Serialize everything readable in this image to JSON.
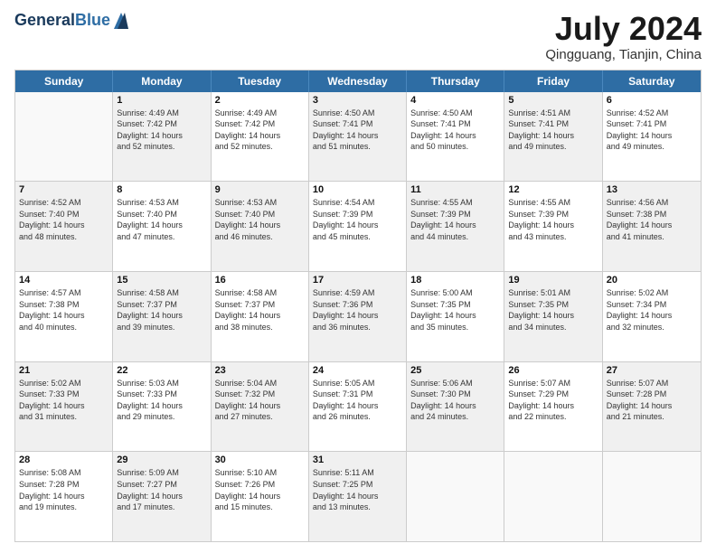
{
  "logo": {
    "general": "General",
    "blue": "Blue"
  },
  "title": "July 2024",
  "location": "Qingguang, Tianjin, China",
  "days_of_week": [
    "Sunday",
    "Monday",
    "Tuesday",
    "Wednesday",
    "Thursday",
    "Friday",
    "Saturday"
  ],
  "weeks": [
    [
      {
        "day": "",
        "sunrise": "",
        "sunset": "",
        "daylight": "",
        "shaded": false,
        "empty": true
      },
      {
        "day": "1",
        "sunrise": "Sunrise: 4:49 AM",
        "sunset": "Sunset: 7:42 PM",
        "daylight": "Daylight: 14 hours and 52 minutes.",
        "shaded": true
      },
      {
        "day": "2",
        "sunrise": "Sunrise: 4:49 AM",
        "sunset": "Sunset: 7:42 PM",
        "daylight": "Daylight: 14 hours and 52 minutes.",
        "shaded": false
      },
      {
        "day": "3",
        "sunrise": "Sunrise: 4:50 AM",
        "sunset": "Sunset: 7:41 PM",
        "daylight": "Daylight: 14 hours and 51 minutes.",
        "shaded": true
      },
      {
        "day": "4",
        "sunrise": "Sunrise: 4:50 AM",
        "sunset": "Sunset: 7:41 PM",
        "daylight": "Daylight: 14 hours and 50 minutes.",
        "shaded": false
      },
      {
        "day": "5",
        "sunrise": "Sunrise: 4:51 AM",
        "sunset": "Sunset: 7:41 PM",
        "daylight": "Daylight: 14 hours and 49 minutes.",
        "shaded": true
      },
      {
        "day": "6",
        "sunrise": "Sunrise: 4:52 AM",
        "sunset": "Sunset: 7:41 PM",
        "daylight": "Daylight: 14 hours and 49 minutes.",
        "shaded": false
      }
    ],
    [
      {
        "day": "7",
        "sunrise": "Sunrise: 4:52 AM",
        "sunset": "Sunset: 7:40 PM",
        "daylight": "Daylight: 14 hours and 48 minutes.",
        "shaded": true
      },
      {
        "day": "8",
        "sunrise": "Sunrise: 4:53 AM",
        "sunset": "Sunset: 7:40 PM",
        "daylight": "Daylight: 14 hours and 47 minutes.",
        "shaded": false
      },
      {
        "day": "9",
        "sunrise": "Sunrise: 4:53 AM",
        "sunset": "Sunset: 7:40 PM",
        "daylight": "Daylight: 14 hours and 46 minutes.",
        "shaded": true
      },
      {
        "day": "10",
        "sunrise": "Sunrise: 4:54 AM",
        "sunset": "Sunset: 7:39 PM",
        "daylight": "Daylight: 14 hours and 45 minutes.",
        "shaded": false
      },
      {
        "day": "11",
        "sunrise": "Sunrise: 4:55 AM",
        "sunset": "Sunset: 7:39 PM",
        "daylight": "Daylight: 14 hours and 44 minutes.",
        "shaded": true
      },
      {
        "day": "12",
        "sunrise": "Sunrise: 4:55 AM",
        "sunset": "Sunset: 7:39 PM",
        "daylight": "Daylight: 14 hours and 43 minutes.",
        "shaded": false
      },
      {
        "day": "13",
        "sunrise": "Sunrise: 4:56 AM",
        "sunset": "Sunset: 7:38 PM",
        "daylight": "Daylight: 14 hours and 41 minutes.",
        "shaded": true
      }
    ],
    [
      {
        "day": "14",
        "sunrise": "Sunrise: 4:57 AM",
        "sunset": "Sunset: 7:38 PM",
        "daylight": "Daylight: 14 hours and 40 minutes.",
        "shaded": false
      },
      {
        "day": "15",
        "sunrise": "Sunrise: 4:58 AM",
        "sunset": "Sunset: 7:37 PM",
        "daylight": "Daylight: 14 hours and 39 minutes.",
        "shaded": true
      },
      {
        "day": "16",
        "sunrise": "Sunrise: 4:58 AM",
        "sunset": "Sunset: 7:37 PM",
        "daylight": "Daylight: 14 hours and 38 minutes.",
        "shaded": false
      },
      {
        "day": "17",
        "sunrise": "Sunrise: 4:59 AM",
        "sunset": "Sunset: 7:36 PM",
        "daylight": "Daylight: 14 hours and 36 minutes.",
        "shaded": true
      },
      {
        "day": "18",
        "sunrise": "Sunrise: 5:00 AM",
        "sunset": "Sunset: 7:35 PM",
        "daylight": "Daylight: 14 hours and 35 minutes.",
        "shaded": false
      },
      {
        "day": "19",
        "sunrise": "Sunrise: 5:01 AM",
        "sunset": "Sunset: 7:35 PM",
        "daylight": "Daylight: 14 hours and 34 minutes.",
        "shaded": true
      },
      {
        "day": "20",
        "sunrise": "Sunrise: 5:02 AM",
        "sunset": "Sunset: 7:34 PM",
        "daylight": "Daylight: 14 hours and 32 minutes.",
        "shaded": false
      }
    ],
    [
      {
        "day": "21",
        "sunrise": "Sunrise: 5:02 AM",
        "sunset": "Sunset: 7:33 PM",
        "daylight": "Daylight: 14 hours and 31 minutes.",
        "shaded": true
      },
      {
        "day": "22",
        "sunrise": "Sunrise: 5:03 AM",
        "sunset": "Sunset: 7:33 PM",
        "daylight": "Daylight: 14 hours and 29 minutes.",
        "shaded": false
      },
      {
        "day": "23",
        "sunrise": "Sunrise: 5:04 AM",
        "sunset": "Sunset: 7:32 PM",
        "daylight": "Daylight: 14 hours and 27 minutes.",
        "shaded": true
      },
      {
        "day": "24",
        "sunrise": "Sunrise: 5:05 AM",
        "sunset": "Sunset: 7:31 PM",
        "daylight": "Daylight: 14 hours and 26 minutes.",
        "shaded": false
      },
      {
        "day": "25",
        "sunrise": "Sunrise: 5:06 AM",
        "sunset": "Sunset: 7:30 PM",
        "daylight": "Daylight: 14 hours and 24 minutes.",
        "shaded": true
      },
      {
        "day": "26",
        "sunrise": "Sunrise: 5:07 AM",
        "sunset": "Sunset: 7:29 PM",
        "daylight": "Daylight: 14 hours and 22 minutes.",
        "shaded": false
      },
      {
        "day": "27",
        "sunrise": "Sunrise: 5:07 AM",
        "sunset": "Sunset: 7:28 PM",
        "daylight": "Daylight: 14 hours and 21 minutes.",
        "shaded": true
      }
    ],
    [
      {
        "day": "28",
        "sunrise": "Sunrise: 5:08 AM",
        "sunset": "Sunset: 7:28 PM",
        "daylight": "Daylight: 14 hours and 19 minutes.",
        "shaded": false
      },
      {
        "day": "29",
        "sunrise": "Sunrise: 5:09 AM",
        "sunset": "Sunset: 7:27 PM",
        "daylight": "Daylight: 14 hours and 17 minutes.",
        "shaded": true
      },
      {
        "day": "30",
        "sunrise": "Sunrise: 5:10 AM",
        "sunset": "Sunset: 7:26 PM",
        "daylight": "Daylight: 14 hours and 15 minutes.",
        "shaded": false
      },
      {
        "day": "31",
        "sunrise": "Sunrise: 5:11 AM",
        "sunset": "Sunset: 7:25 PM",
        "daylight": "Daylight: 14 hours and 13 minutes.",
        "shaded": true
      },
      {
        "day": "",
        "sunrise": "",
        "sunset": "",
        "daylight": "",
        "shaded": false,
        "empty": true
      },
      {
        "day": "",
        "sunrise": "",
        "sunset": "",
        "daylight": "",
        "shaded": false,
        "empty": true
      },
      {
        "day": "",
        "sunrise": "",
        "sunset": "",
        "daylight": "",
        "shaded": false,
        "empty": true
      }
    ]
  ]
}
